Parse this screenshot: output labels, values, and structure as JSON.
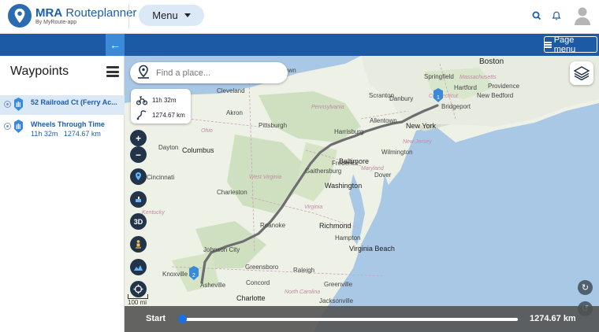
{
  "app": {
    "title_bold": "MRA",
    "title_rest": "Routeplanner",
    "subtitle": "By MyRoute-app",
    "menu_label": "Menu",
    "page_menu_label": "Page menu"
  },
  "icons": {
    "logo": "map-pin-logo-icon",
    "search": "search-icon",
    "notifications": "bell-icon",
    "avatar": "user-avatar-icon",
    "collapse": "arrow-left-icon",
    "burger": "hamburger-icon",
    "layers": "layers-icon"
  },
  "sidebar": {
    "title": "Waypoints",
    "waypoints": [
      {
        "name": "52 Railroad Ct (Ferry Ac...",
        "detail_time": "",
        "detail_distance": "",
        "active": true
      },
      {
        "name": "Wheels Through Time",
        "detail_time": "11h 32m",
        "detail_distance": "1274.67 km",
        "active": false
      }
    ]
  },
  "map": {
    "search_placeholder": "Find a place...",
    "route_time": "11h 32m",
    "route_distance": "1274.67 km",
    "zoom_in": "+",
    "zoom_out": "−",
    "btn_3d": "3D",
    "scale_label": "100 mi",
    "marker_start": "1",
    "marker_end": "2",
    "labels": {
      "boston": "Boston",
      "springfield": "Springfield",
      "hartford": "Hartford",
      "providence": "Providence",
      "new_bedford": "New Bedford",
      "bridgeport": "Bridgeport",
      "danbury": "Danbury",
      "new_york": "New York",
      "scranton": "Scranton",
      "allentown": "Allentown",
      "cleveland": "Cleveland",
      "akron": "Akron",
      "pittsburgh": "Pittsburgh",
      "harrisburg": "Harrisburg",
      "wilmington": "Wilmington",
      "dayton": "Dayton",
      "columbus": "Columbus",
      "cincinnati": "Cincinnati",
      "frederick": "Frederick",
      "baltimore": "Baltimore",
      "gaithersburg": "Gaithersburg",
      "washington": "Washington",
      "dover": "Dover",
      "charleston": "Charleston",
      "richmond": "Richmond",
      "roanoke": "Roanoke",
      "hampton": "Hampton",
      "virginia_beach": "Virginia Beach",
      "johnson_city": "Johnson City",
      "knoxville": "Knoxville",
      "greensboro": "Greensboro",
      "raleigh": "Raleigh",
      "asheville": "Asheville",
      "concord": "Concord",
      "greenville": "Greenville",
      "charlotte": "Charlotte",
      "jacksonville": "Jacksonville",
      "pennsylvania": "Pennsylvania",
      "ohio": "Ohio",
      "new_jersey": "New Jersey",
      "west_virginia": "West Virginia",
      "virginia": "Virginia",
      "kentucky": "Kentucky",
      "north_carolina": "North Carolina",
      "massachusetts": "Massachusetts",
      "connecticut": "Connecticut",
      "rhode_island": "Rhode Island",
      "maryland": "Maryland",
      "allentown_state": "",
      "town_left": "Town",
      "indiana_edge": "ville",
      "columbia": "Columbia"
    }
  },
  "bottom": {
    "start_label": "Start",
    "distance": "1274.67 km",
    "progress": 0
  },
  "colors": {
    "brand_blue": "#1c5aa5",
    "light_blue": "#dbe8f6",
    "accent": "#3a8ad8",
    "route": "#6e6e72",
    "control_dark": "#23344a"
  }
}
